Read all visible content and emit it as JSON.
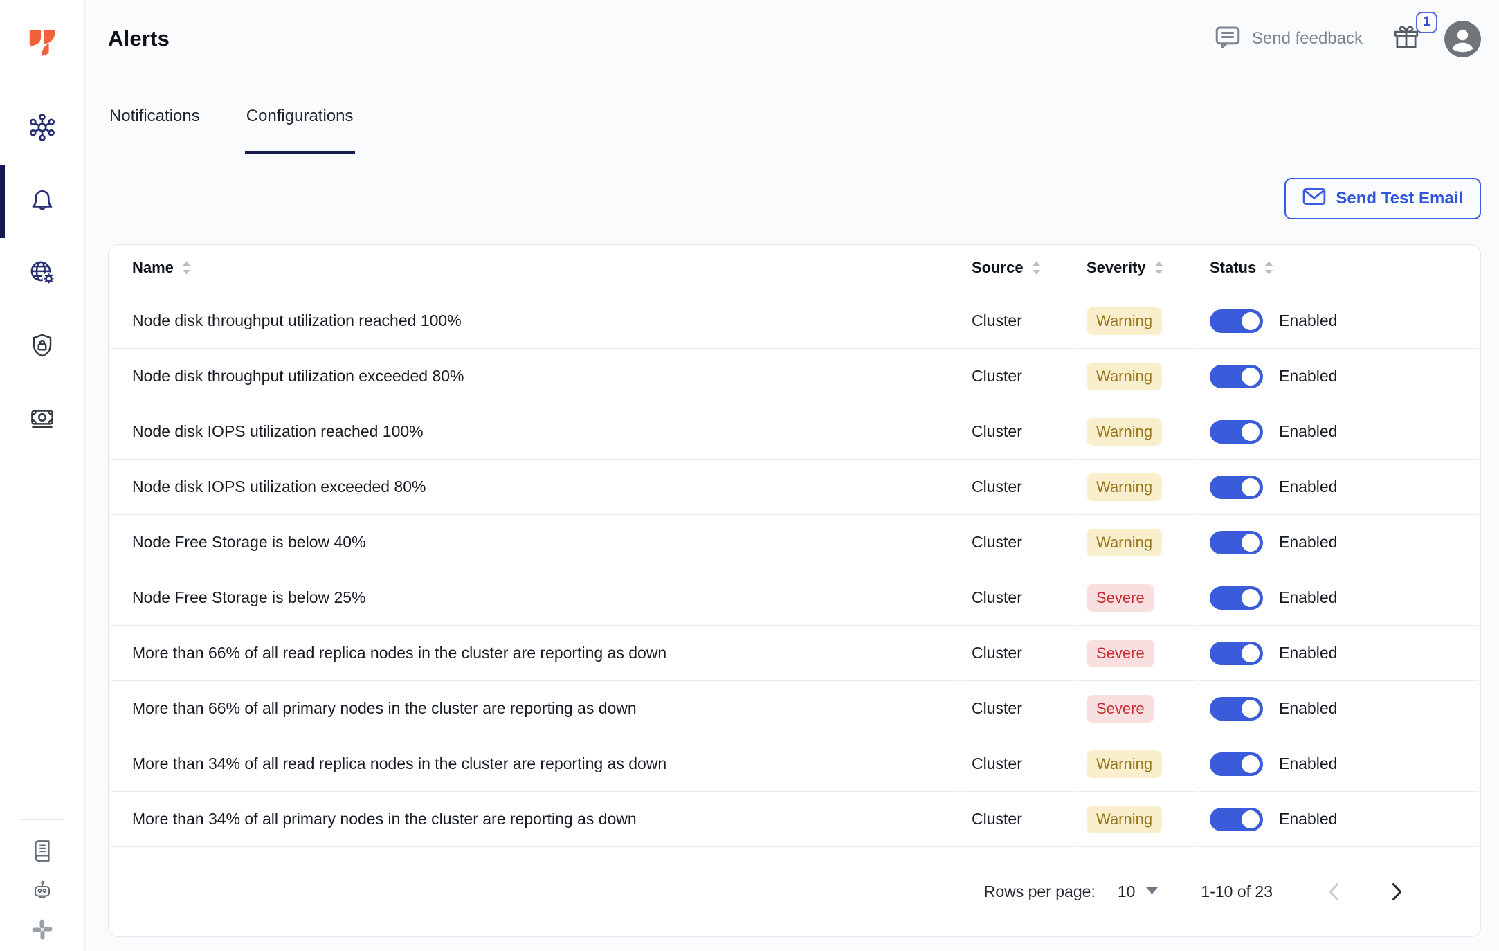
{
  "page": {
    "title": "Alerts"
  },
  "header": {
    "send_feedback": "Send feedback",
    "gift_badge_count": "1"
  },
  "tabs": {
    "notifications": "Notifications",
    "configurations": "Configurations",
    "active": "Configurations"
  },
  "toolbar": {
    "send_test_email": "Send Test Email"
  },
  "sidebar": {
    "nav": [
      {
        "icon": "cluster-network-icon",
        "active": false
      },
      {
        "icon": "bell-icon",
        "active": true
      },
      {
        "icon": "globe-settings-icon",
        "active": false
      },
      {
        "icon": "shield-lock-icon",
        "active": false
      },
      {
        "icon": "billing-icon",
        "active": false
      }
    ],
    "footer_nav": [
      {
        "icon": "docs-book-icon"
      },
      {
        "icon": "robot-assistant-icon"
      },
      {
        "icon": "slack-icon"
      }
    ]
  },
  "table": {
    "columns": [
      "Name",
      "Source",
      "Severity",
      "Status"
    ],
    "rows": [
      {
        "name": "Node disk throughput utilization reached 100%",
        "source": "Cluster",
        "severity": "Warning",
        "status": "Enabled",
        "enabled": true
      },
      {
        "name": "Node disk throughput utilization exceeded 80%",
        "source": "Cluster",
        "severity": "Warning",
        "status": "Enabled",
        "enabled": true
      },
      {
        "name": "Node disk IOPS utilization reached 100%",
        "source": "Cluster",
        "severity": "Warning",
        "status": "Enabled",
        "enabled": true
      },
      {
        "name": "Node disk IOPS utilization exceeded 80%",
        "source": "Cluster",
        "severity": "Warning",
        "status": "Enabled",
        "enabled": true
      },
      {
        "name": "Node Free Storage is below 40%",
        "source": "Cluster",
        "severity": "Warning",
        "status": "Enabled",
        "enabled": true
      },
      {
        "name": "Node Free Storage is below 25%",
        "source": "Cluster",
        "severity": "Severe",
        "status": "Enabled",
        "enabled": true
      },
      {
        "name": "More than 66% of all read replica nodes in the cluster are reporting as down",
        "source": "Cluster",
        "severity": "Severe",
        "status": "Enabled",
        "enabled": true
      },
      {
        "name": "More than 66% of all primary nodes in the cluster are reporting as down",
        "source": "Cluster",
        "severity": "Severe",
        "status": "Enabled",
        "enabled": true
      },
      {
        "name": "More than 34% of all read replica nodes in the cluster are reporting as down",
        "source": "Cluster",
        "severity": "Warning",
        "status": "Enabled",
        "enabled": true
      },
      {
        "name": "More than 34% of all primary nodes in the cluster are reporting as down",
        "source": "Cluster",
        "severity": "Warning",
        "status": "Enabled",
        "enabled": true
      }
    ]
  },
  "pagination": {
    "rows_per_page_label": "Rows per page:",
    "rows_per_page_value": "10",
    "range": "1-10 of 23"
  },
  "colors": {
    "accent_blue": "#3A5CDB",
    "navy_icon": "#262F72",
    "active_indicator": "#141A51",
    "logo_orange": "#F4603A",
    "warning_bg": "#FAEFCD",
    "warning_text": "#97771D",
    "severe_bg": "#F8DFE0",
    "severe_text": "#CD2B33"
  }
}
